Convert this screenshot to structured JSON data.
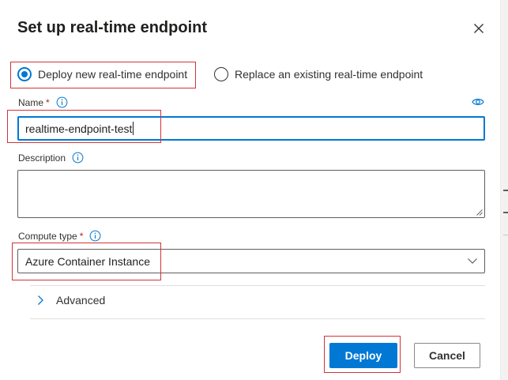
{
  "dialog": {
    "title": "Set up real-time endpoint",
    "close_icon": "close-icon"
  },
  "mode": {
    "options": [
      {
        "label": "Deploy new real-time endpoint",
        "selected": true
      },
      {
        "label": "Replace an existing real-time endpoint",
        "selected": false
      }
    ]
  },
  "name_field": {
    "label": "Name",
    "required_mark": "*",
    "value": "realtime-endpoint-test",
    "info_icon": "info-icon",
    "visibility_icon": "eye-icon"
  },
  "description_field": {
    "label": "Description",
    "value": "",
    "info_icon": "info-icon"
  },
  "compute_type": {
    "label": "Compute type",
    "required_mark": "*",
    "selected": "Azure Container Instance",
    "info_icon": "info-icon",
    "dropdown_icon": "chevron-down-icon"
  },
  "advanced": {
    "label": "Advanced",
    "expanded": false,
    "icon": "chevron-right-icon"
  },
  "actions": {
    "primary": "Deploy",
    "secondary": "Cancel"
  },
  "colors": {
    "accent": "#0078d4",
    "highlight_box": "#d13438",
    "required": "#a4262c",
    "text": "#323130"
  }
}
